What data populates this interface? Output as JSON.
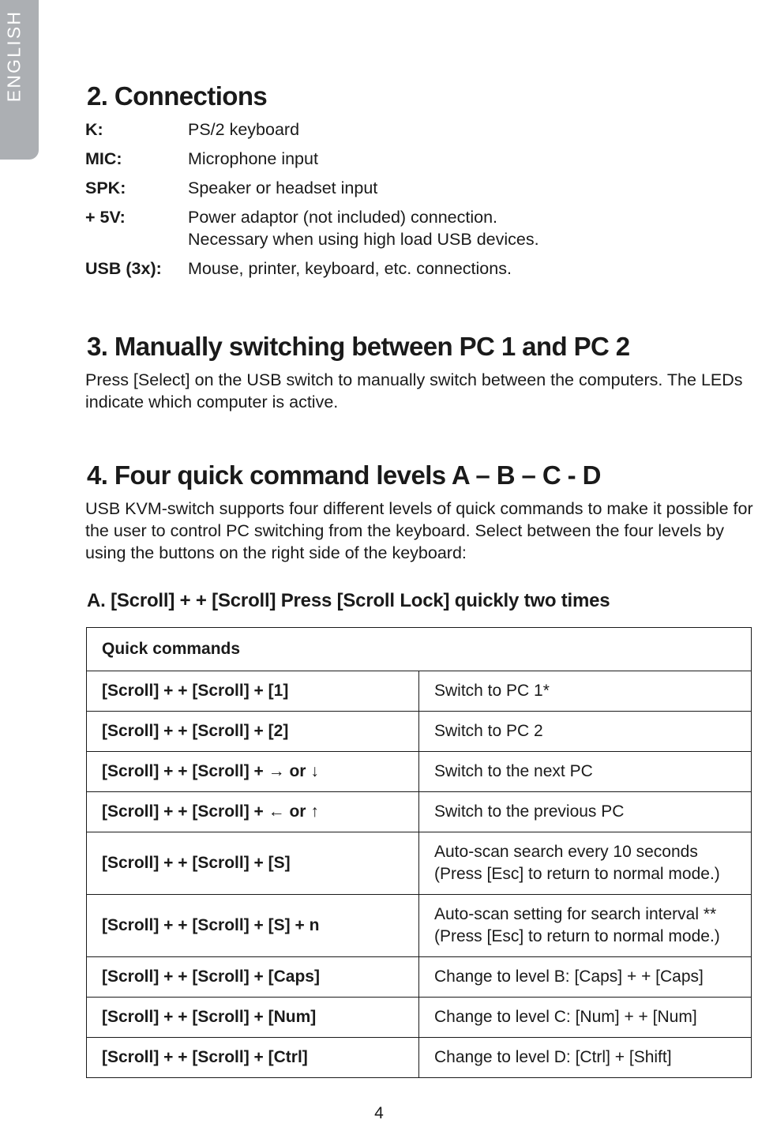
{
  "language_tab": {
    "label": "ENGLISH",
    "background_color": "#acafb3",
    "text_color": "#ffffff"
  },
  "sections": {
    "connections": {
      "heading": "2. Connections",
      "items": [
        {
          "term": "K:",
          "definition": [
            "PS/2 keyboard"
          ]
        },
        {
          "term": "MIC:",
          "definition": [
            "Microphone input"
          ]
        },
        {
          "term": "SPK:",
          "definition": [
            "Speaker or headset input"
          ]
        },
        {
          "term": "+ 5V:",
          "definition": [
            "Power adaptor (not included) connection.",
            "Necessary when using high load USB devices."
          ]
        },
        {
          "term": "USB (3x):",
          "definition": [
            "Mouse, printer, keyboard, etc. connections."
          ]
        }
      ]
    },
    "manual_switching": {
      "heading": "3. Manually switching between PC 1 and PC 2",
      "body": "Press [Select] on the USB switch to manually switch between the computers. The LEDs indicate which computer is active."
    },
    "quick_levels": {
      "heading": "4. Four quick command levels A – B – C - D",
      "body": "USB KVM-switch supports four different levels of quick commands to make it possible for the user to control PC switching from the keyboard. Select between the four levels by using the buttons on the right side of the keyboard:",
      "level_a_line": "A. [Scroll] + + [Scroll] Press [Scroll Lock] quickly two times"
    }
  },
  "quick_command_table": {
    "header": "Quick commands",
    "rows": [
      {
        "command": "[Scroll] + + [Scroll] + [1]",
        "description": [
          "Switch to PC 1*"
        ]
      },
      {
        "command": "[Scroll] + + [Scroll] + [2]",
        "description": [
          "Switch to PC 2"
        ]
      },
      {
        "command": "[Scroll] + + [Scroll] + → or ↓",
        "description": [
          "Switch to the next PC"
        ]
      },
      {
        "command": "[Scroll] + + [Scroll] + ← or ↑",
        "description": [
          "Switch to the previous PC"
        ]
      },
      {
        "command": "[Scroll] + + [Scroll] + [S]",
        "description": [
          "Auto-scan search every 10 seconds",
          "(Press [Esc] to return to normal mode.)"
        ]
      },
      {
        "command": "[Scroll] + + [Scroll] + [S] + n",
        "description": [
          "Auto-scan setting for search interval **",
          "(Press [Esc] to return to normal mode.)"
        ]
      },
      {
        "command": "[Scroll] + + [Scroll] + [Caps]",
        "description": [
          "Change to level B: [Caps] + + [Caps]"
        ]
      },
      {
        "command": "[Scroll] + + [Scroll] + [Num]",
        "description": [
          "Change to level C: [Num] + + [Num]"
        ]
      },
      {
        "command": "[Scroll] + + [Scroll] + [Ctrl]",
        "description": [
          "Change to level D: [Ctrl] + [Shift]"
        ]
      }
    ]
  },
  "footer": {
    "page_number": "4"
  }
}
